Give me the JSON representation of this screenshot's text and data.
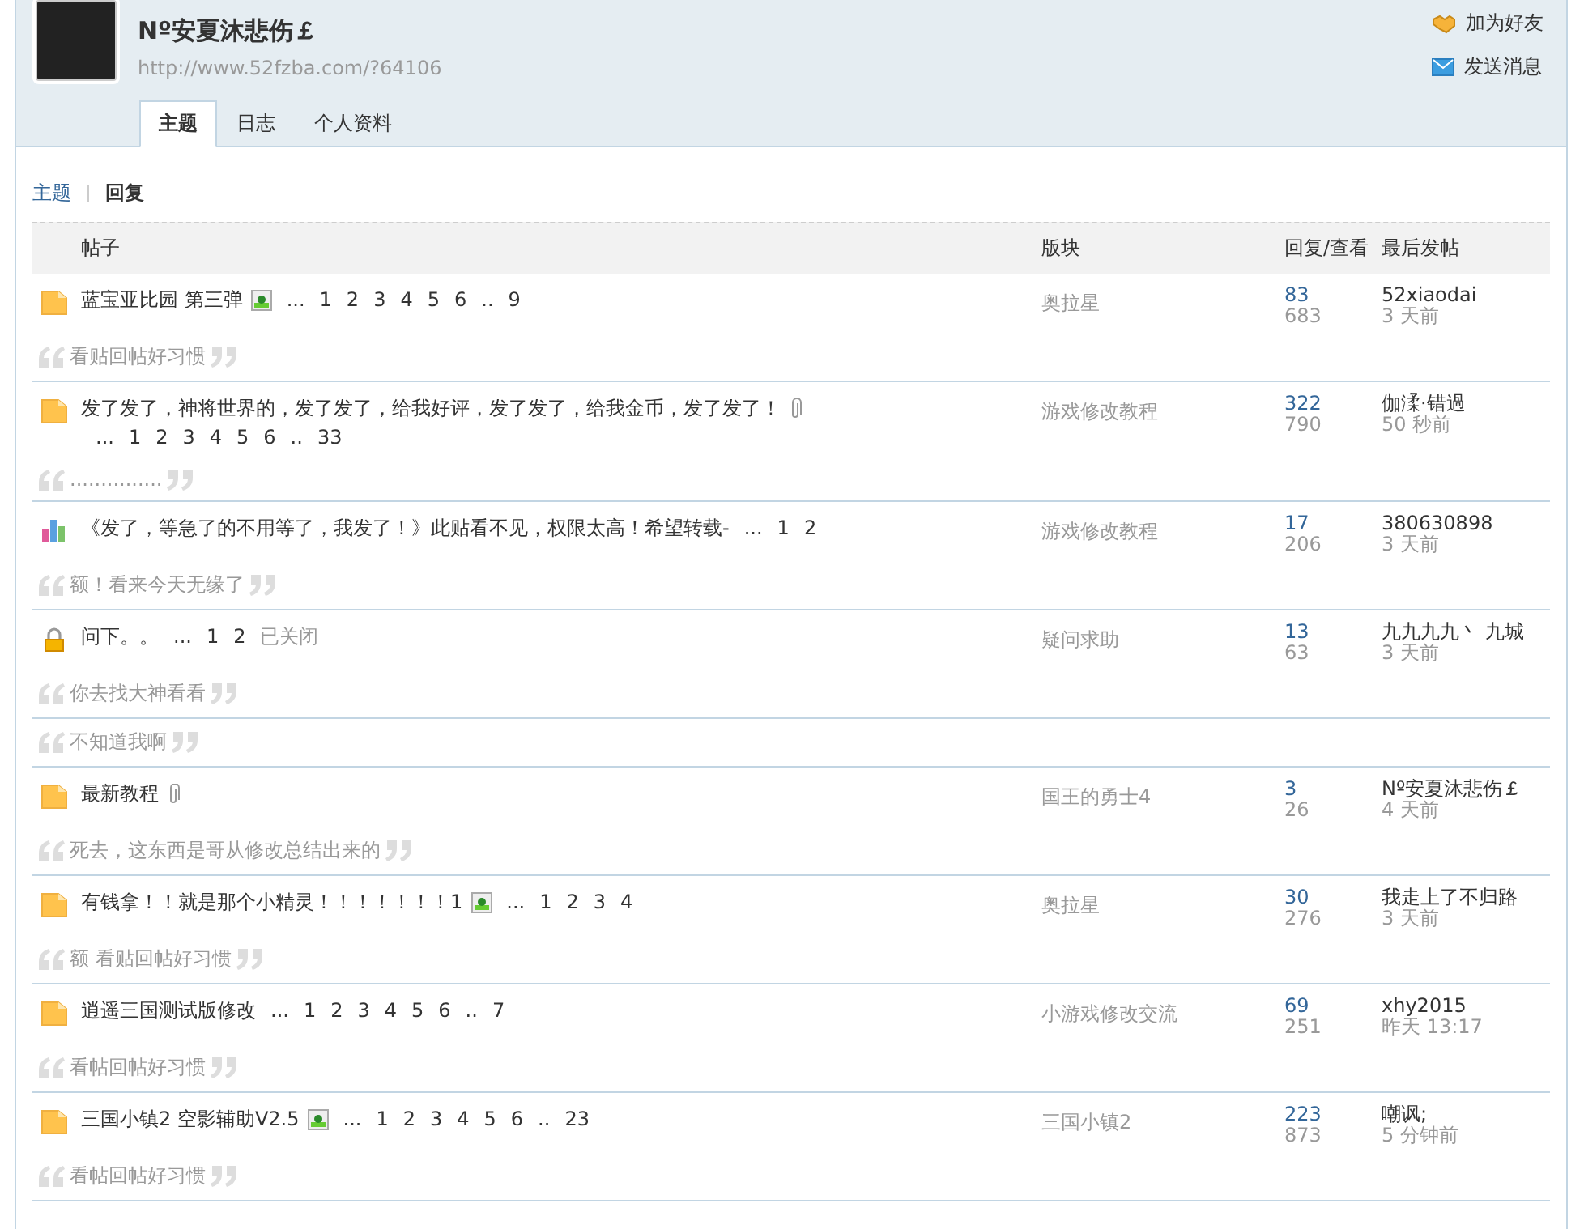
{
  "profile": {
    "name": "Nº安夏沐悲伤￡",
    "url": "http://www.52fzba.com/?64106",
    "actions": [
      {
        "kind": "friend",
        "label": "加为好友"
      },
      {
        "kind": "message",
        "label": "发送消息"
      }
    ]
  },
  "tabs": [
    {
      "label": "主题",
      "selected": true
    },
    {
      "label": "日志",
      "selected": false
    },
    {
      "label": "个人资料",
      "selected": false
    }
  ],
  "subnav": [
    {
      "label": "主题",
      "selected": false
    },
    {
      "label": "回复",
      "selected": true
    }
  ],
  "table": {
    "columns": [
      "帖子",
      "版块",
      "回复/查看",
      "最后发帖"
    ],
    "rows": [
      {
        "kind": "folder",
        "title": "蓝宝亚比园 第三弹",
        "image": true,
        "attachment": false,
        "pages": [
          "...",
          "1",
          "2",
          "3",
          "4",
          "5",
          "6",
          "..",
          "9"
        ],
        "status": "",
        "forum": "奥拉星",
        "replies": "83",
        "views": "683",
        "author": "52xiaodai",
        "time": "3 天前",
        "quotes": [
          "看贴回帖好习惯"
        ]
      },
      {
        "kind": "folder",
        "title": "发了发了，神将世界的，发了发了，给我好评，发了发了，给我金币，发了发了！",
        "image": false,
        "attachment": true,
        "pages": [
          "...",
          "1",
          "2",
          "3",
          "4",
          "5",
          "6",
          "..",
          "33"
        ],
        "status": "",
        "forum": "游戏修改教程",
        "replies": "322",
        "views": "790",
        "author": "伽渘·错過",
        "time": "50 秒前",
        "quotes": [
          "..............."
        ]
      },
      {
        "kind": "poll",
        "title": "《发了，等急了的不用等了，我发了！》此贴看不见，权限太高！希望转载-",
        "image": false,
        "attachment": false,
        "pages": [
          "...",
          "1",
          "2"
        ],
        "status": "",
        "forum": "游戏修改教程",
        "replies": "17",
        "views": "206",
        "author": "380630898",
        "time": "3 天前",
        "quotes": [
          "额！看来今天无缘了"
        ]
      },
      {
        "kind": "locked",
        "title": "问下。。",
        "image": false,
        "attachment": false,
        "pages": [
          "...",
          "1",
          "2"
        ],
        "status": "已关闭",
        "forum": "疑问求助",
        "replies": "13",
        "views": "63",
        "author": "九九九九丶 九城",
        "time": "3 天前",
        "quotes": [
          "你去找大神看看",
          "不知道我啊"
        ]
      },
      {
        "kind": "folder",
        "title": "最新教程",
        "image": false,
        "attachment": true,
        "pages": [],
        "status": "",
        "forum": "国王的勇士4",
        "replies": "3",
        "views": "26",
        "author": "Nº安夏沐悲伤￡",
        "time": "4 天前",
        "quotes": [
          "死去，这东西是哥从修改总结出来的"
        ]
      },
      {
        "kind": "folder",
        "title": "有钱拿！！就是那个小精灵！！！！！！！1",
        "image": true,
        "attachment": false,
        "pages": [
          "...",
          "1",
          "2",
          "3",
          "4"
        ],
        "status": "",
        "forum": "奥拉星",
        "replies": "30",
        "views": "276",
        "author": "我走上了不归路",
        "time": "3 天前",
        "quotes": [
          "额 看贴回帖好习惯"
        ]
      },
      {
        "kind": "folder",
        "title": "逍遥三国测试版修改",
        "image": false,
        "attachment": false,
        "pages": [
          "...",
          "1",
          "2",
          "3",
          "4",
          "5",
          "6",
          "..",
          "7"
        ],
        "status": "",
        "forum": "小游戏修改交流",
        "replies": "69",
        "views": "251",
        "author": "xhy2015",
        "time": "昨天 13:17",
        "quotes": [
          "看帖回帖好习惯"
        ]
      },
      {
        "kind": "folder",
        "title": "三国小镇2 空影辅助V2.5",
        "image": true,
        "attachment": false,
        "pages": [
          "...",
          "1",
          "2",
          "3",
          "4",
          "5",
          "6",
          "..",
          "23"
        ],
        "status": "",
        "forum": "三国小镇2",
        "replies": "223",
        "views": "873",
        "author": "嘲讽;",
        "time": "5 分钟前",
        "quotes": [
          "看帖回帖好习惯"
        ]
      }
    ]
  }
}
